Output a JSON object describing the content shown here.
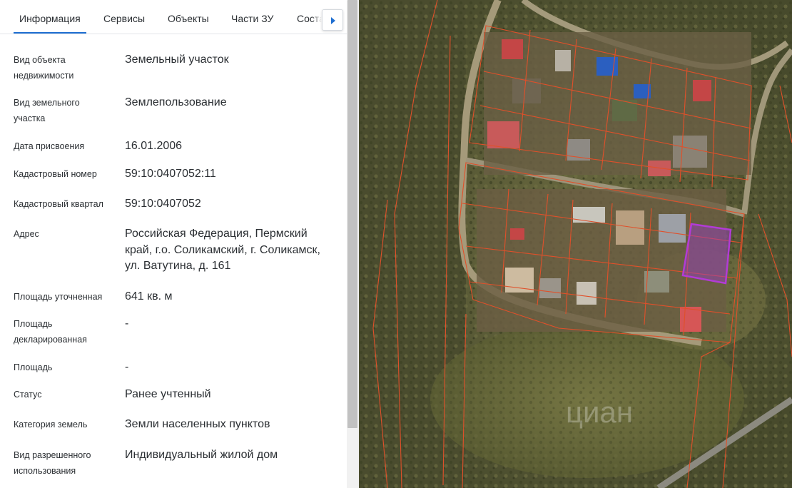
{
  "tabs": [
    {
      "label": "Информация",
      "active": true
    },
    {
      "label": "Сервисы",
      "active": false
    },
    {
      "label": "Объекты",
      "active": false
    },
    {
      "label": "Части ЗУ",
      "active": false
    },
    {
      "label": "Соста",
      "active": false
    }
  ],
  "fields": [
    {
      "label": "Вид объекта недвижимости",
      "value": "Земельный участок"
    },
    {
      "label": "Вид земельного участка",
      "value": "Землепользование"
    },
    {
      "label": "Дата присвоения",
      "value": "16.01.2006"
    },
    {
      "label": "Кадастровый номер",
      "value": "59:10:0407052:11"
    },
    {
      "label": "Кадастровый квартал",
      "value": "59:10:0407052"
    },
    {
      "label": "Адрес",
      "value": "Российская Федерация, Пермский край, г.о. Соликамский, г. Соликамск, ул. Ватутина, д. 161"
    },
    {
      "label": "Площадь уточненная",
      "value": "641 кв. м"
    },
    {
      "label": "Площадь декларированная",
      "value": "-"
    },
    {
      "label": "Площадь",
      "value": "-"
    },
    {
      "label": "Статус",
      "value": "Ранее учтенный"
    },
    {
      "label": "Категория земель",
      "value": "Земли населенных пунктов"
    },
    {
      "label": "Вид разрешенного использования",
      "value": "Индивидуальный жилой дом"
    }
  ],
  "icons": {
    "tab_scroll": "chevron-right-icon"
  },
  "map": {
    "watermark": "циан",
    "colors": {
      "boundary": "#e0502a",
      "selected_parcel": "#b23bd6",
      "accent": "#1f6fd1"
    }
  }
}
